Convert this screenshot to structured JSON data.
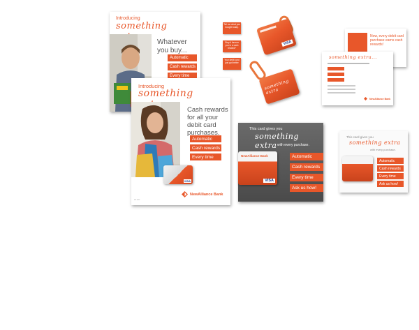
{
  "brand": {
    "accent": "#e8572a",
    "bank_name": "NewAlliance Bank"
  },
  "poster_back": {
    "intro": "Introducing",
    "script": "something extra...",
    "headline": [
      "Whatever",
      "you buy..."
    ],
    "pills": [
      "Automatic",
      "Cash rewards",
      "Every time"
    ]
  },
  "poster_front": {
    "intro": "Introducing",
    "script": "something extra...",
    "headline": [
      "Cash rewards",
      "for all your",
      "debit card",
      "purchases."
    ],
    "pills": [
      "Automatic",
      "Cash rewards",
      "Every time"
    ],
    "logo": "NewAlliance Bank"
  },
  "tags": [
    "Tell me what you bought today.",
    "Stay it forever you in a cash reward?",
    "Your debit card just got better"
  ],
  "display": {
    "line1": "This card gives you",
    "script": "something extra",
    "line2": "with every purchase.",
    "pills": [
      "Automatic",
      "Cash rewards",
      "Every time",
      "Ask us how!"
    ],
    "card_bank": "NewAlliance Bank",
    "card_brand": "VISA"
  },
  "mailer": {
    "headline": "Now, every debit card purchase earns cash rewards!",
    "script": "something extra...",
    "logo": "NewAlliance Bank"
  },
  "tent": {
    "line1": "This card gives you",
    "script": "something extra",
    "line2": "with every purchase.",
    "pills": [
      "Automatic",
      "Cash rewards",
      "Every time",
      "Ask us how!"
    ]
  },
  "keycards": {
    "script": "something extra",
    "card_brand": "VISA"
  }
}
